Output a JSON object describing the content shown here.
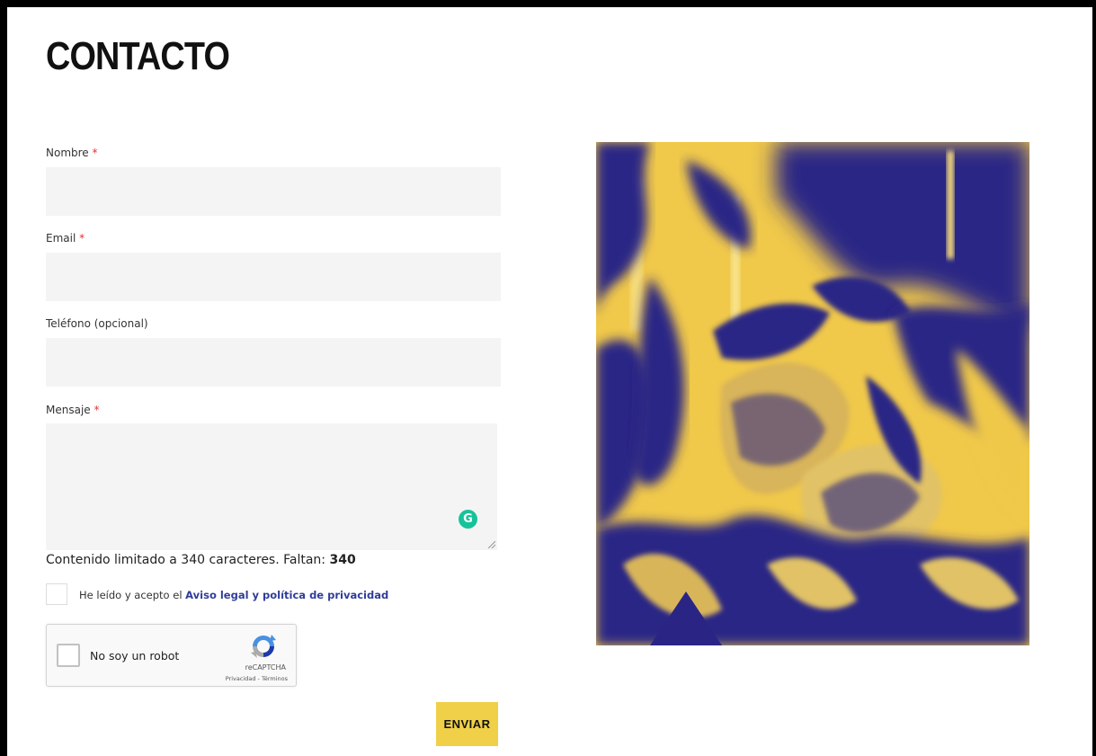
{
  "page": {
    "title": "CONTACTO"
  },
  "form": {
    "fields": [
      {
        "label": "Nombre",
        "required": true,
        "value": "",
        "placeholder": ""
      },
      {
        "label": "Email",
        "required": true,
        "value": "",
        "placeholder": ""
      },
      {
        "label": "Teléfono (opcional)",
        "required": false,
        "value": "",
        "placeholder": ""
      },
      {
        "label": "Mensaje",
        "required": true,
        "value": "",
        "placeholder": ""
      }
    ],
    "required_mark": "*",
    "char_limit": {
      "text": "Contenido limitado a 340 caracteres. Faltan:",
      "remaining": "340"
    },
    "consent": {
      "text": "He leído y acepto el ",
      "link_text": "Aviso legal y política de privacidad"
    },
    "recaptcha": {
      "label": "No soy un robot",
      "brand": "reCAPTCHA",
      "terms": "Privacidad - Términos"
    },
    "submit_label": "ENVIAR"
  },
  "colors": {
    "accent_yellow": "#efd048",
    "image_blue": "#2a2585",
    "image_yellow": "#f0c84a",
    "link_blue": "#2f3d9a",
    "required_red": "#dd3333",
    "field_bg": "#f4f4f4"
  },
  "icons": {
    "grammarly": "grammarly-icon",
    "recaptcha": "recaptcha-logo-icon"
  }
}
